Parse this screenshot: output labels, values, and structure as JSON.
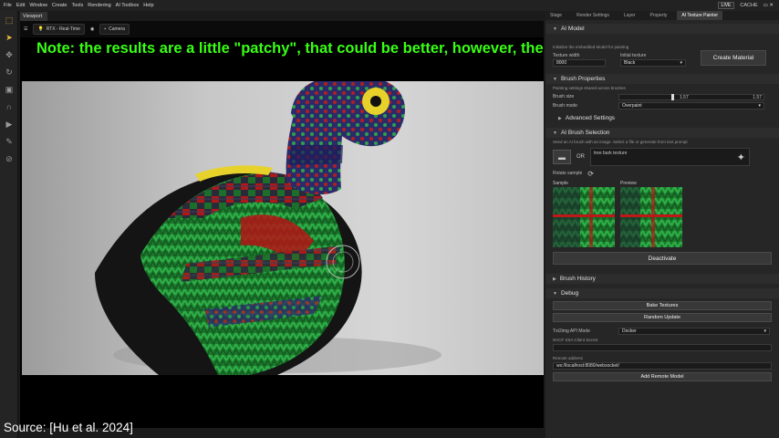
{
  "menu": [
    "File",
    "Edit",
    "Window",
    "Create",
    "Tools",
    "Rendering",
    "AI Toolbox",
    "Help"
  ],
  "status": {
    "live": "LIVE",
    "cache": "CACHE"
  },
  "viewport": {
    "tab": "Viewport",
    "renderer": "RTX - Real-Time",
    "camera": "Camera",
    "note": "Note: the results are a little \"patchy\", that could be better, however, the patterns are not repeating",
    "source": "Source: [Hu et al. 2024]",
    "axis": "Y  X"
  },
  "panel": {
    "tabs": [
      "Stage",
      "Render Settings",
      "Layer",
      "Property",
      "AI Texture Painter"
    ],
    "ai_model": {
      "title": "AI Model",
      "hint": "Initialize the embedded Model for painting",
      "texture_width_label": "Texture width",
      "texture_width": "8000",
      "initial_texture_label": "Initial texture",
      "initial_texture": "Black",
      "create_material": "Create Material"
    },
    "brush": {
      "title": "Brush Properties",
      "hint": "Painting settings shared across brushes",
      "size_label": "Brush size",
      "size_value": "1.57",
      "size_max": "1.57",
      "size_level": 0.82,
      "mode_label": "Brush mode",
      "mode_value": "Overpaint",
      "advanced": "Advanced Settings"
    },
    "selection": {
      "title": "AI Brush Selection",
      "hint": "Seed an AI brush with an image. Select a file or generate from text prompt",
      "or": "OR",
      "prompt": "tree bark texture",
      "rotate": "Rotate sample",
      "sample_label": "Sample",
      "preview_label": "Preview",
      "deactivate": "Deactivate"
    },
    "history": {
      "title": "Brush History"
    },
    "debug": {
      "title": "Debug",
      "bake": "Bake Textures",
      "random": "Random Update",
      "api_label": "Txt2img API Mode",
      "api_value": "Docker",
      "nvcf_label": "NVCF SSA Client Secret",
      "remote_label": "Remote address",
      "remote_value": "ws://localhost:8080/websocket/",
      "add_remote": "Add Remote Model"
    }
  }
}
